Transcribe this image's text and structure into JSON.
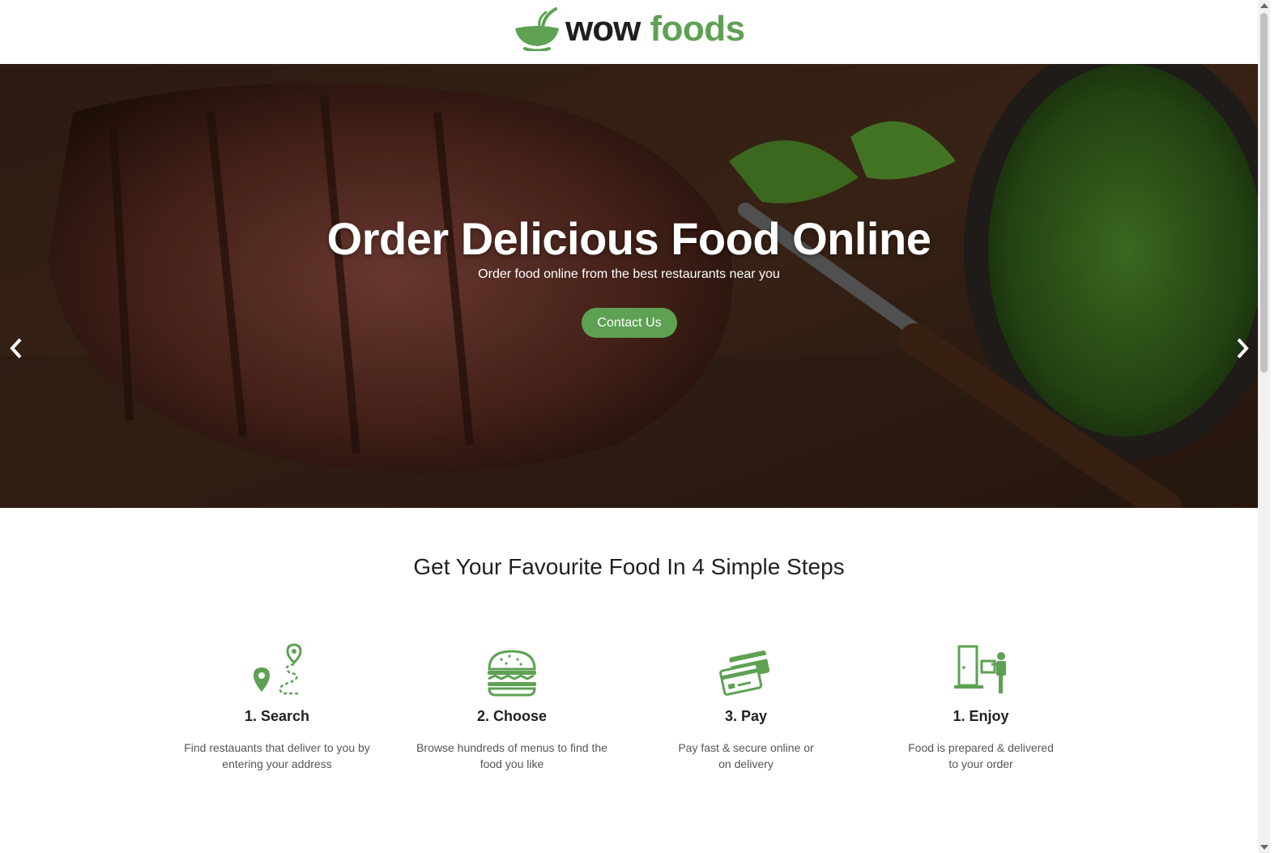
{
  "brand": {
    "name_part1": "wow",
    "name_part2": "foods",
    "accent": "#5ea153",
    "dark": "#1f1f1f"
  },
  "hero": {
    "title": "Order Delicious Food Online",
    "subtitle": "Order food online from the best restaurants near you",
    "cta_label": "Contact Us",
    "prev_icon": "chevron-left-icon",
    "next_icon": "chevron-right-icon"
  },
  "steps_section": {
    "heading": "Get Your Favourite Food In 4 Simple Steps",
    "steps": [
      {
        "icon": "map-route-icon",
        "title": "1. Search",
        "desc_line1": "Find restauants that deliver to you by",
        "desc_line2": "entering your address"
      },
      {
        "icon": "burger-icon",
        "title": "2. Choose",
        "desc_line1": "Browse hundreds of menus to find the",
        "desc_line2": "food you like"
      },
      {
        "icon": "credit-cards-icon",
        "title": "3. Pay",
        "desc_line1": "Pay fast & secure online or",
        "desc_line2": "on delivery"
      },
      {
        "icon": "delivery-door-icon",
        "title": "1. Enjoy",
        "desc_line1": "Food is prepared & delivered",
        "desc_line2": "to your order"
      }
    ]
  }
}
